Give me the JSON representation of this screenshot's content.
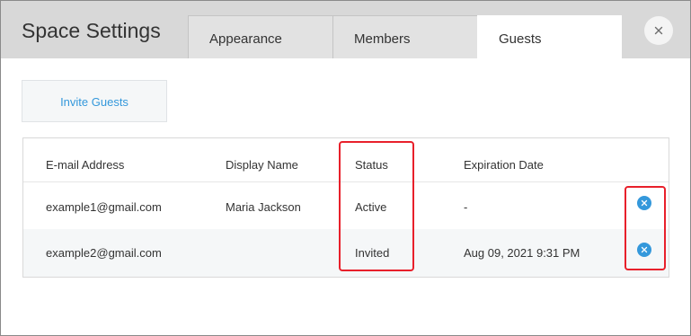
{
  "header": {
    "title": "Space Settings",
    "tabs": [
      {
        "label": "Appearance",
        "active": false
      },
      {
        "label": "Members",
        "active": false
      },
      {
        "label": "Guests",
        "active": true
      }
    ],
    "close_icon": "close-icon"
  },
  "actions": {
    "invite_label": "Invite Guests"
  },
  "guests_table": {
    "columns": [
      "E-mail Address",
      "Display Name",
      "Status",
      "Expiration Date"
    ],
    "rows": [
      {
        "email": "example1@gmail.com",
        "display_name": "Maria Jackson",
        "status": "Active",
        "expiration": "-",
        "remove_icon": "remove-icon"
      },
      {
        "email": "example2@gmail.com",
        "display_name": "",
        "status": "Invited",
        "expiration": "Aug 09, 2021 9:31 PM",
        "remove_icon": "remove-icon"
      }
    ]
  },
  "colors": {
    "accent": "#3498db",
    "highlight": "#e8202b",
    "header_bg": "#d8d8d8"
  }
}
